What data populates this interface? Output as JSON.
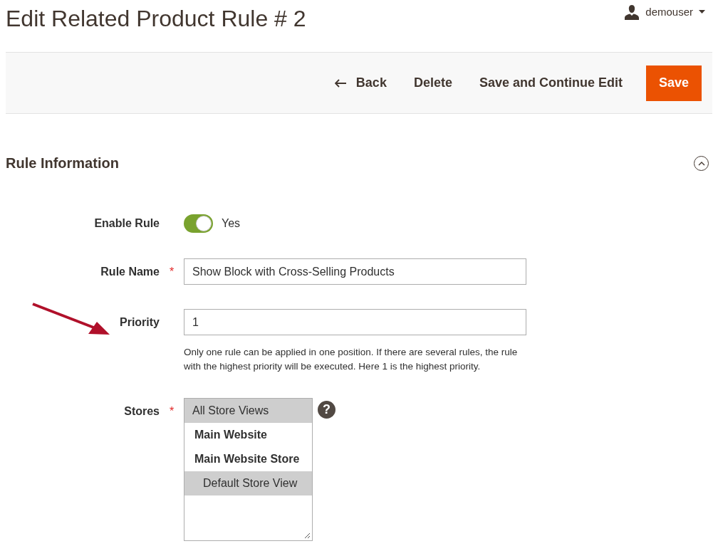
{
  "page_title": "Edit Related Product Rule # 2",
  "user": {
    "name": "demouser"
  },
  "actions": [
    {
      "label": "Back",
      "kind": "back"
    },
    {
      "label": "Delete",
      "kind": "plain"
    },
    {
      "label": "Save and Continue Edit",
      "kind": "plain"
    },
    {
      "label": "Save",
      "kind": "primary"
    }
  ],
  "section": {
    "title": "Rule Information",
    "expanded": true
  },
  "fields": [
    {
      "kind": "toggle",
      "label": "Enable Rule",
      "on": true,
      "value": "Yes"
    },
    {
      "kind": "text",
      "label": "Rule Name",
      "required_mark": "*",
      "value": "Show Block with Cross-Selling Products"
    },
    {
      "kind": "text",
      "label": "Priority",
      "value": "1",
      "annotated": true,
      "note": "Only one rule can be applied in one position. If there are several rules, the rule with the highest priority will be executed. Here 1 is the highest priority."
    },
    {
      "kind": "multiselect",
      "label": "Stores",
      "required_mark": "*",
      "help": "?",
      "options": [
        {
          "label": "All Store Views",
          "kind": "all",
          "selected": true
        },
        {
          "label": "Main Website",
          "kind": "website",
          "selected": false
        },
        {
          "label": "Main Website Store",
          "kind": "store",
          "selected": false
        },
        {
          "label": "Default Store View",
          "kind": "view",
          "selected": true
        }
      ]
    }
  ]
}
